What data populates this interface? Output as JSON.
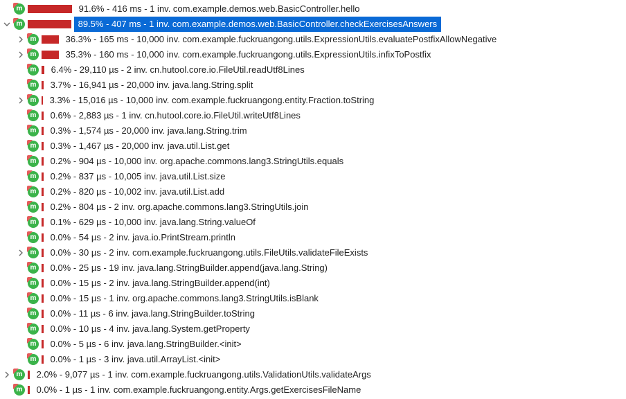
{
  "colors": {
    "accent": "#0a6ad6",
    "bar": "#c62828",
    "badge": "#3bb34a"
  },
  "rows": [
    {
      "depth": 0,
      "arrow": "none",
      "bar_pct": 91.6,
      "selected": false,
      "text": "91.6% - 416 ms - 1 inv. com.example.demos.web.BasicController.hello"
    },
    {
      "depth": 0,
      "arrow": "down",
      "bar_pct": 89.5,
      "selected": true,
      "text": "89.5% - 407 ms - 1 inv. com.example.demos.web.BasicController.checkExercisesAnswers"
    },
    {
      "depth": 1,
      "arrow": "right",
      "bar_pct": 36.3,
      "selected": false,
      "text": "36.3% - 165 ms - 10,000 inv. com.example.fuckruangong.utils.ExpressionUtils.evaluatePostfixAllowNegative"
    },
    {
      "depth": 1,
      "arrow": "right",
      "bar_pct": 35.3,
      "selected": false,
      "text": "35.3% - 160 ms - 10,000 inv. com.example.fuckruangong.utils.ExpressionUtils.infixToPostfix"
    },
    {
      "depth": 1,
      "arrow": "none",
      "bar_pct": 6.4,
      "selected": false,
      "text": "6.4% - 29,110 µs - 2 inv. cn.hutool.core.io.FileUtil.readUtf8Lines"
    },
    {
      "depth": 1,
      "arrow": "none",
      "bar_pct": 3.7,
      "selected": false,
      "text": "3.7% - 16,941 µs - 20,000 inv. java.lang.String.split"
    },
    {
      "depth": 1,
      "arrow": "right",
      "bar_pct": 3.3,
      "selected": false,
      "text": "3.3% - 15,016 µs - 10,000 inv. com.example.fuckruangong.entity.Fraction.toString"
    },
    {
      "depth": 1,
      "arrow": "none",
      "bar_pct": 0.6,
      "selected": false,
      "text": "0.6% - 2,883 µs - 1 inv. cn.hutool.core.io.FileUtil.writeUtf8Lines"
    },
    {
      "depth": 1,
      "arrow": "none",
      "bar_pct": 0.3,
      "selected": false,
      "text": "0.3% - 1,574 µs - 20,000 inv. java.lang.String.trim"
    },
    {
      "depth": 1,
      "arrow": "none",
      "bar_pct": 0.3,
      "selected": false,
      "text": "0.3% - 1,467 µs - 20,000 inv. java.util.List.get"
    },
    {
      "depth": 1,
      "arrow": "none",
      "bar_pct": 0.2,
      "selected": false,
      "text": "0.2% - 904 µs - 10,000 inv. org.apache.commons.lang3.StringUtils.equals"
    },
    {
      "depth": 1,
      "arrow": "none",
      "bar_pct": 0.2,
      "selected": false,
      "text": "0.2% - 837 µs - 10,005 inv. java.util.List.size"
    },
    {
      "depth": 1,
      "arrow": "none",
      "bar_pct": 0.2,
      "selected": false,
      "text": "0.2% - 820 µs - 10,002 inv. java.util.List.add"
    },
    {
      "depth": 1,
      "arrow": "none",
      "bar_pct": 0.2,
      "selected": false,
      "text": "0.2% - 804 µs - 2 inv. org.apache.commons.lang3.StringUtils.join"
    },
    {
      "depth": 1,
      "arrow": "none",
      "bar_pct": 0.1,
      "selected": false,
      "text": "0.1% - 629 µs - 10,000 inv. java.lang.String.valueOf"
    },
    {
      "depth": 1,
      "arrow": "none",
      "bar_pct": 0.0,
      "selected": false,
      "text": "0.0% - 54 µs - 2 inv. java.io.PrintStream.println"
    },
    {
      "depth": 1,
      "arrow": "right",
      "bar_pct": 0.0,
      "selected": false,
      "text": "0.0% - 30 µs - 2 inv. com.example.fuckruangong.utils.FileUtils.validateFileExists"
    },
    {
      "depth": 1,
      "arrow": "none",
      "bar_pct": 0.0,
      "selected": false,
      "text": "0.0% - 25 µs - 19 inv. java.lang.StringBuilder.append(java.lang.String)"
    },
    {
      "depth": 1,
      "arrow": "none",
      "bar_pct": 0.0,
      "selected": false,
      "text": "0.0% - 15 µs - 2 inv. java.lang.StringBuilder.append(int)"
    },
    {
      "depth": 1,
      "arrow": "none",
      "bar_pct": 0.0,
      "selected": false,
      "text": "0.0% - 15 µs - 1 inv. org.apache.commons.lang3.StringUtils.isBlank"
    },
    {
      "depth": 1,
      "arrow": "none",
      "bar_pct": 0.0,
      "selected": false,
      "text": "0.0% - 11 µs - 6 inv. java.lang.StringBuilder.toString"
    },
    {
      "depth": 1,
      "arrow": "none",
      "bar_pct": 0.0,
      "selected": false,
      "text": "0.0% - 10 µs - 4 inv. java.lang.System.getProperty"
    },
    {
      "depth": 1,
      "arrow": "none",
      "bar_pct": 0.0,
      "selected": false,
      "text": "0.0% - 5 µs - 6 inv. java.lang.StringBuilder.<init>"
    },
    {
      "depth": 1,
      "arrow": "none",
      "bar_pct": 0.0,
      "selected": false,
      "text": "0.0% - 1 µs - 3 inv. java.util.ArrayList.<init>"
    },
    {
      "depth": 0,
      "arrow": "right",
      "bar_pct": 2.0,
      "selected": false,
      "text": "2.0% - 9,077 µs - 1 inv. com.example.fuckruangong.utils.ValidationUtils.validateArgs"
    },
    {
      "depth": 0,
      "arrow": "none",
      "bar_pct": 0.0,
      "selected": false,
      "text": "0.0% - 1 µs - 1 inv. com.example.fuckruangong.entity.Args.getExercisesFileName"
    }
  ]
}
